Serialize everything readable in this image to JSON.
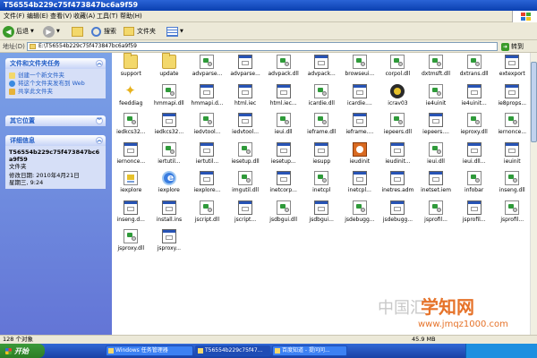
{
  "window": {
    "title": "T56554b229c75f473847bc6a9f59"
  },
  "menu": [
    "文件(F)",
    "编辑(E)",
    "查看(V)",
    "收藏(A)",
    "工具(T)",
    "帮助(H)"
  ],
  "toolbar": {
    "back_label": "后退",
    "search_label": "搜索",
    "folders_label": "文件夹"
  },
  "address": {
    "label": "地址(D)",
    "value": "E:\\T56554b229c75f473847bc6a9f59",
    "go_label": "转到"
  },
  "left_panel": {
    "tasks_title": "文件和文件夹任务",
    "tasks": [
      "创建一个新文件夹",
      "将这个文件夹发布到 Web",
      "共享此文件夹"
    ],
    "other_title": "其它位置",
    "details_title": "详细信息",
    "details_name": "T56554b229c75f473847bc6a9f59",
    "details_type": "文件夹",
    "details_modified_label": "修改日期: 2010年4月21日",
    "details_modified_time": "星期三, 9:24"
  },
  "files": [
    {
      "name": "support",
      "icon": "folder-icon"
    },
    {
      "name": "update",
      "icon": "folder-icon"
    },
    {
      "name": "advparse...",
      "icon": "dll-icon"
    },
    {
      "name": "advparse...",
      "icon": "exe-icon"
    },
    {
      "name": "advpack.dll",
      "icon": "dll-icon"
    },
    {
      "name": "advpack...",
      "icon": "exe-icon"
    },
    {
      "name": "browseui...",
      "icon": "dll-icon"
    },
    {
      "name": "corpol.dll",
      "icon": "dll-icon"
    },
    {
      "name": "dxtmsft.dll",
      "icon": "dll-icon"
    },
    {
      "name": "dxtrans.dll",
      "icon": "dll-icon"
    },
    {
      "name": "extexport",
      "icon": "exe-icon"
    },
    {
      "name": "feeddiag",
      "icon": "star-icon"
    },
    {
      "name": "hmmapi.dll",
      "icon": "dll-icon"
    },
    {
      "name": "hmmapi.d...",
      "icon": "exe-icon"
    },
    {
      "name": "html.iec",
      "icon": "exe-icon"
    },
    {
      "name": "html.iec...",
      "icon": "exe-icon"
    },
    {
      "name": "icardie.dll",
      "icon": "dll-icon"
    },
    {
      "name": "icardie....",
      "icon": "exe-icon"
    },
    {
      "name": "icrav03",
      "icon": "gear-icon"
    },
    {
      "name": "ie4uinit",
      "icon": "dll-icon"
    },
    {
      "name": "ie4uinit...",
      "icon": "exe-icon"
    },
    {
      "name": "ie8props...",
      "icon": "exe-icon"
    },
    {
      "name": "iedkcs32...",
      "icon": "dll-icon"
    },
    {
      "name": "iedkcs32...",
      "icon": "exe-icon"
    },
    {
      "name": "iedvtool...",
      "icon": "dll-icon"
    },
    {
      "name": "iedvtool...",
      "icon": "exe-icon"
    },
    {
      "name": "ieui.dll",
      "icon": "dll-icon"
    },
    {
      "name": "ieframe.dll",
      "icon": "dll-icon"
    },
    {
      "name": "ieframe....",
      "icon": "exe-icon"
    },
    {
      "name": "iepeers.dll",
      "icon": "dll-icon"
    },
    {
      "name": "iepeers....",
      "icon": "exe-icon"
    },
    {
      "name": "ieproxy.dll",
      "icon": "dll-icon"
    },
    {
      "name": "iernonce...",
      "icon": "dll-icon"
    },
    {
      "name": "iernonce...",
      "icon": "exe-icon"
    },
    {
      "name": "iertutil...",
      "icon": "dll-icon"
    },
    {
      "name": "iertutil...",
      "icon": "exe-icon"
    },
    {
      "name": "iesetup.dll",
      "icon": "dll-icon"
    },
    {
      "name": "iesetup...",
      "icon": "exe-icon"
    },
    {
      "name": "iesupp",
      "icon": "exe-icon"
    },
    {
      "name": "ieudinit",
      "icon": "ieorange-icon"
    },
    {
      "name": "ieudinit...",
      "icon": "exe-icon"
    },
    {
      "name": "ieui.dll",
      "icon": "dll-icon"
    },
    {
      "name": "ieui.dll...",
      "icon": "exe-icon"
    },
    {
      "name": "ieuinit",
      "icon": "exe-icon"
    },
    {
      "name": "iexplore",
      "icon": "doc-icon"
    },
    {
      "name": "iexplore",
      "icon": "ie-icon"
    },
    {
      "name": "iexplore...",
      "icon": "exe-icon"
    },
    {
      "name": "imgutil.dll",
      "icon": "dll-icon"
    },
    {
      "name": "inetcorp...",
      "icon": "exe-icon"
    },
    {
      "name": "inetcpl",
      "icon": "dll-icon"
    },
    {
      "name": "inetcpl...",
      "icon": "exe-icon"
    },
    {
      "name": "inetres.adm",
      "icon": "exe-icon"
    },
    {
      "name": "inetset.iem",
      "icon": "exe-icon"
    },
    {
      "name": "infobar",
      "icon": "dll-icon"
    },
    {
      "name": "inseng.dll",
      "icon": "dll-icon"
    },
    {
      "name": "inseng.d...",
      "icon": "exe-icon"
    },
    {
      "name": "install.ins",
      "icon": "exe-icon"
    },
    {
      "name": "jscript.dll",
      "icon": "dll-icon"
    },
    {
      "name": "jscript...",
      "icon": "exe-icon"
    },
    {
      "name": "jsdbgui.dll",
      "icon": "dll-icon"
    },
    {
      "name": "jsdbgui...",
      "icon": "exe-icon"
    },
    {
      "name": "jsdebugg...",
      "icon": "dll-icon"
    },
    {
      "name": "jsdebugg...",
      "icon": "exe-icon"
    },
    {
      "name": "jsprofil...",
      "icon": "dll-icon"
    },
    {
      "name": "jsprofil...",
      "icon": "exe-icon"
    },
    {
      "name": "jsprofil...",
      "icon": "dll-icon"
    },
    {
      "name": "jsproxy.dll",
      "icon": "dll-icon"
    },
    {
      "name": "jsproxy...",
      "icon": "exe-icon"
    }
  ],
  "status": {
    "left": "128 个对象",
    "right": "45.9 MB"
  },
  "taskbar": {
    "start_label": "开始",
    "tasks": [
      "Windows 任务管理器",
      "T56554b229c75f47...",
      "百度知道 - 提问问..."
    ]
  },
  "watermark": {
    "main": "学知网",
    "sub": "www.jmqz1000.com",
    "ghost": "中国汇"
  }
}
